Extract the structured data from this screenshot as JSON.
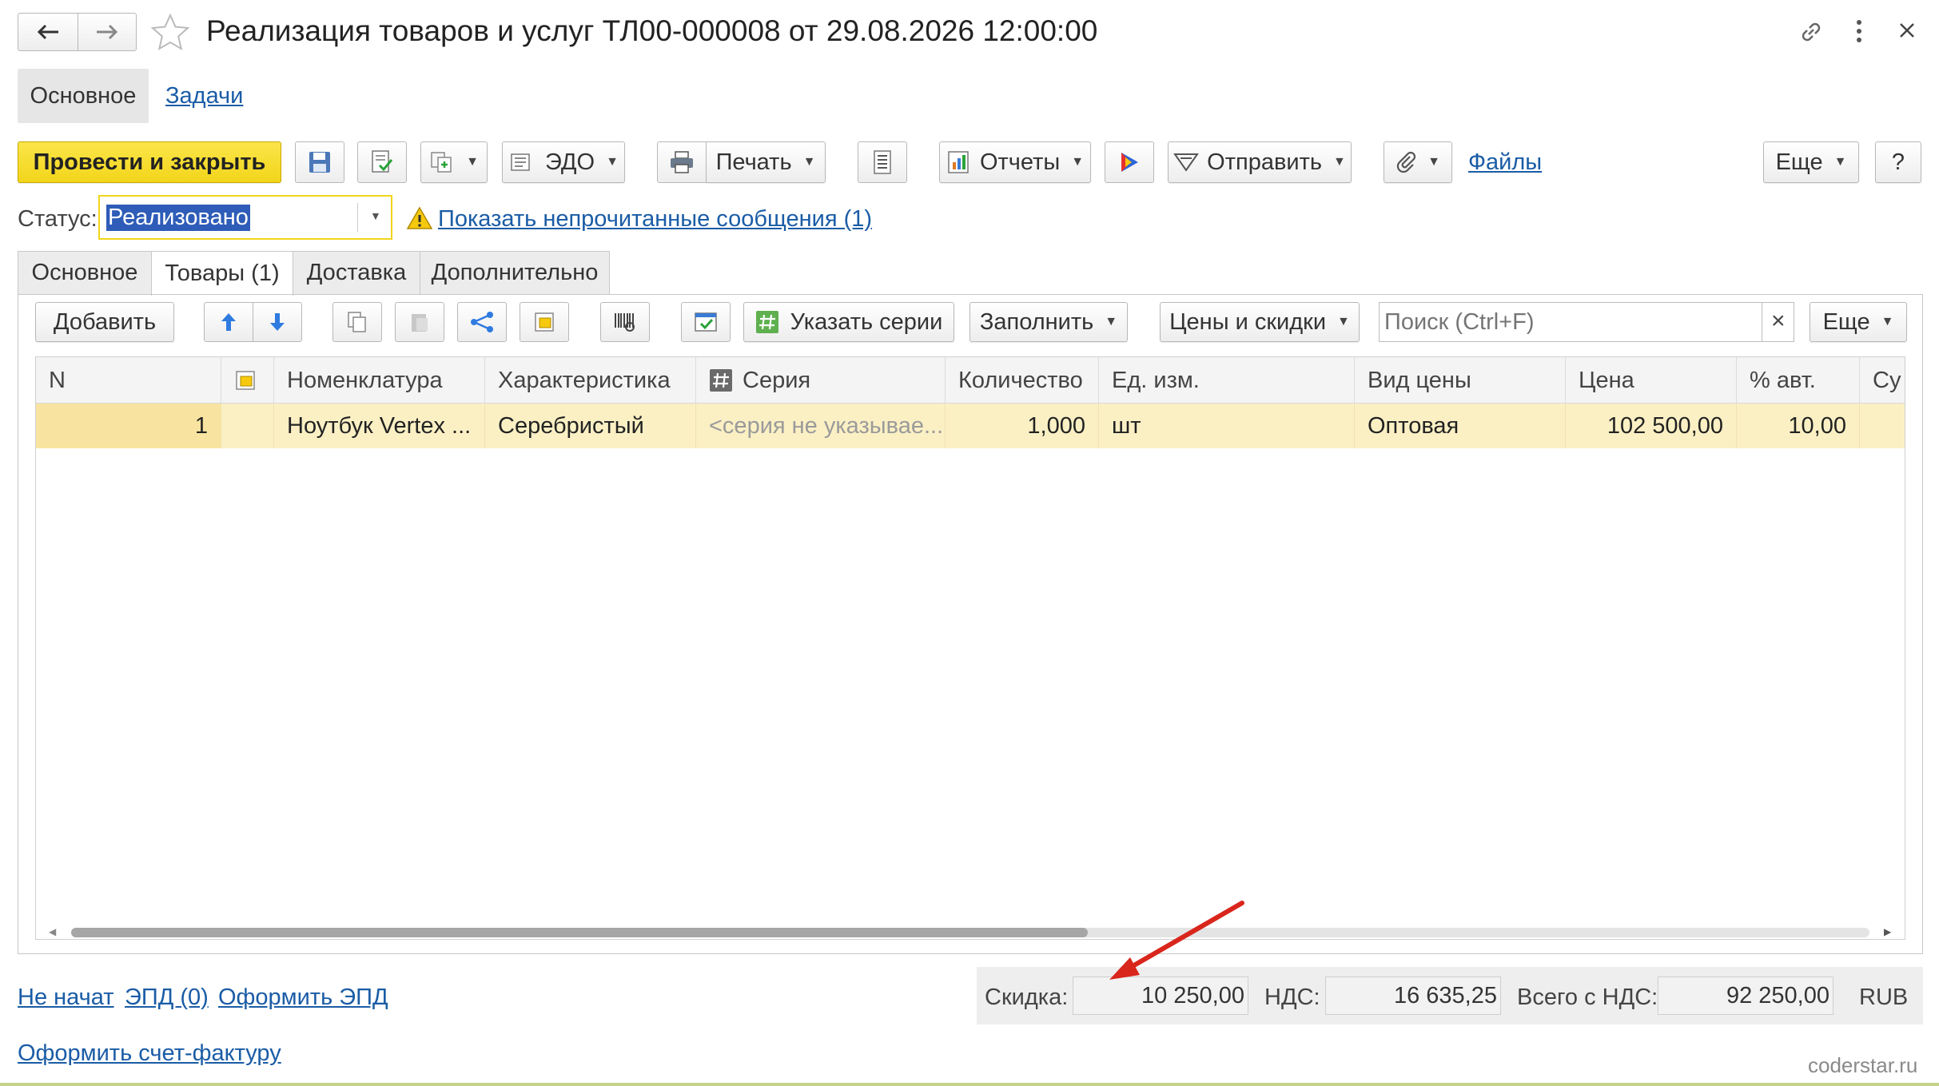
{
  "header": {
    "title": "Реализация товаров и услуг ТЛ00-000008 от 29.08.2026 12:00:00"
  },
  "nav": {
    "main_tab": "Основное",
    "tasks_link": "Задачи"
  },
  "toolbar": {
    "post_close": "Провести и закрыть",
    "edo": "ЭДО",
    "print": "Печать",
    "reports": "Отчеты",
    "send": "Отправить",
    "files": "Файлы",
    "more": "Еще",
    "help": "?"
  },
  "status": {
    "label": "Статус:",
    "value": "Реализовано",
    "messages_link": "Показать непрочитанные сообщения (1)"
  },
  "tabs": [
    {
      "label": "Основное"
    },
    {
      "label": "Товары (1)"
    },
    {
      "label": "Доставка"
    },
    {
      "label": "Дополнительно"
    }
  ],
  "table_toolbar": {
    "add": "Добавить",
    "series": "Указать серии",
    "fill": "Заполнить",
    "prices": "Цены и скидки",
    "search_placeholder": "Поиск (Ctrl+F)",
    "clear": "×",
    "more": "Еще"
  },
  "table": {
    "columns": [
      "N",
      "",
      "Номенклатура",
      "Характеристика",
      "Серия",
      "Количество",
      "Ед. изм.",
      "Вид цены",
      "Цена",
      "% авт.",
      "Су"
    ],
    "rows": [
      {
        "n": "1",
        "item": "Ноутбук Vertex ...",
        "characteristic": "Серебристый",
        "series": "<серия не указывае...",
        "quantity": "1,000",
        "unit": "шт",
        "price_type": "Оптовая",
        "price": "102 500,00",
        "auto_pct": "10,00"
      }
    ]
  },
  "footer": {
    "not_started": "Не начат",
    "epd": "ЭПД (0)",
    "make_epd": "Оформить ЭПД",
    "make_invoice": "Оформить счет-фактуру",
    "discount_label": "Скидка:",
    "discount_value": "10 250,00",
    "vat_label": "НДС:",
    "vat_value": "16 635,25",
    "total_label": "Всего с НДС:",
    "total_value": "92 250,00",
    "currency": "RUB",
    "watermark": "coderstar.ru"
  },
  "colors": {
    "primary_button": "#f5dd2a",
    "selected_row": "#fbf0c4",
    "link": "#1a5ca6",
    "annotation_arrow": "#d9261c"
  }
}
